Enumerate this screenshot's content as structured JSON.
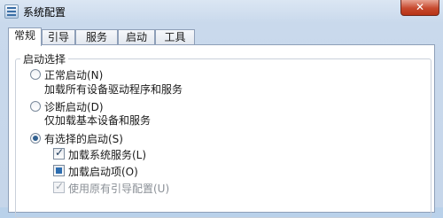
{
  "window": {
    "title": "系统配置",
    "close_label": "✕"
  },
  "tabs": [
    {
      "label": "常规",
      "active": true
    },
    {
      "label": "引导",
      "active": false
    },
    {
      "label": "服务",
      "active": false
    },
    {
      "label": "启动",
      "active": false
    },
    {
      "label": "工具",
      "active": false
    }
  ],
  "startup_group": {
    "legend": "启动选择",
    "normal": {
      "label": "正常启动(N)",
      "desc": "加载所有设备驱动程序和服务",
      "selected": false
    },
    "diagnostic": {
      "label": "诊断启动(D)",
      "desc": "仅加载基本设备和服务",
      "selected": false
    },
    "selective": {
      "label": "有选择的启动(S)",
      "selected": true,
      "options": [
        {
          "label": "加载系统服务(L)",
          "state": "checked",
          "enabled": true
        },
        {
          "label": "加载启动项(O)",
          "state": "indeterminate",
          "enabled": true
        },
        {
          "label": "使用原有引导配置(U)",
          "state": "checked",
          "enabled": false
        }
      ]
    }
  }
}
